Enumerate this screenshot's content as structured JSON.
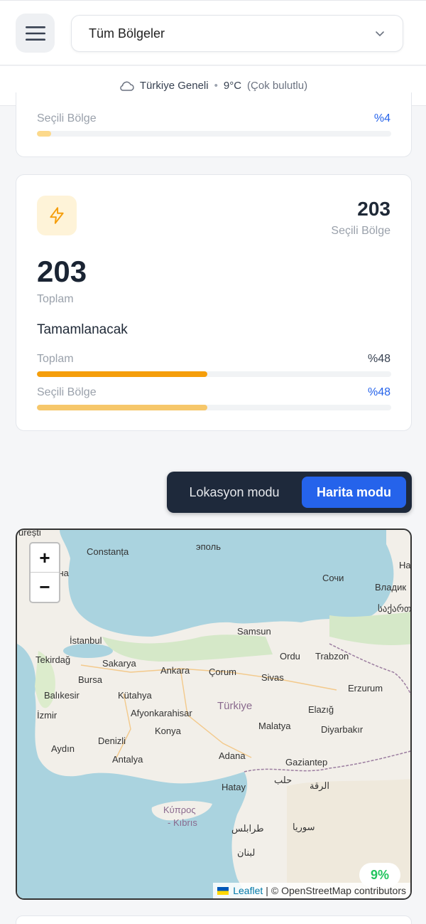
{
  "header": {
    "region_value": "Tüm Bölgeler"
  },
  "weather": {
    "location": "Türkiye Geneli",
    "temperature": "9°C",
    "condition": "(Çok bulutlu)"
  },
  "card1": {
    "selected_label": "Seçili Bölge",
    "selected_pct": "%4",
    "selected_fraction": 0.04
  },
  "card2": {
    "right_value": "203",
    "right_label": "Seçili Bölge",
    "total_value": "203",
    "total_label": "Toplam",
    "section_title": "Tamamlanacak",
    "rows": [
      {
        "label": "Toplam",
        "pct": "%48",
        "fraction": 0.48
      },
      {
        "label": "Seçili Bölge",
        "pct": "%48",
        "fraction": 0.48
      }
    ]
  },
  "mode_toggle": {
    "location_mode": "Lokasyon modu",
    "map_mode": "Harita modu"
  },
  "map": {
    "zoom_in": "+",
    "zoom_out": "−",
    "attribution_leaflet": "Leaflet",
    "attribution_sep": "|",
    "attribution_osm": "© OpenStreetMap contributors",
    "progress_badge": "9%",
    "labels": {
      "bucuresti": "urești",
      "constanta": "Constanța",
      "varna": "арна",
      "sinop_ru": "эполь",
      "sochi": "Сочи",
      "vladik": "Владик",
      "ha": "Ha",
      "georgian": "საქართ",
      "istanbul": "İstanbul",
      "samsun": "Samsun",
      "tekirdag": "Tekirdağ",
      "sakarya": "Sakarya",
      "ordu": "Ordu",
      "trabzon": "Trabzon",
      "ankara": "Ankara",
      "corum": "Çorum",
      "bursa": "Bursa",
      "sivas": "Sivas",
      "erzurum": "Erzurum",
      "balikesir": "Balıkesir",
      "kutahya": "Kütahya",
      "turkiye": "Türkiye",
      "izmir": "İzmir",
      "afyon": "Afyonkarahisar",
      "elazig": "Elazığ",
      "konya": "Konya",
      "malatya": "Malatya",
      "diyarbakir": "Diyarbakır",
      "aydin": "Aydın",
      "denizli": "Denizli",
      "antalya": "Antalya",
      "adana": "Adana",
      "gaziantep": "Gaziantep",
      "hatay": "Hatay",
      "halab": "حلب",
      "raqqa": "الرقة",
      "kypros": "Κύπρος",
      "kibris": "- Kıbrıs",
      "tarablus": "طرابلس",
      "suriya": "سوريا",
      "lubnan": "لبنان"
    }
  },
  "colors": {
    "accent_blue": "#2563eb",
    "orange": "#f59e0b",
    "orange_light": "#f6c76a",
    "light_orange_selected": "#fcd98b",
    "badge_green": "#22c55e"
  }
}
